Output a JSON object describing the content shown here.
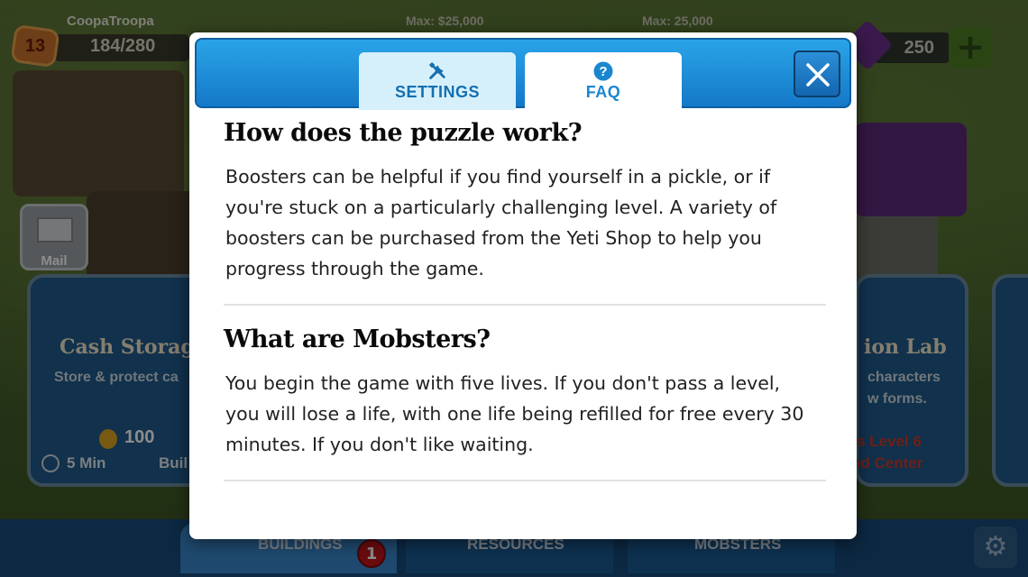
{
  "hud": {
    "player_name": "CoopaTroopa",
    "level": "13",
    "health": "184/280",
    "max_label_1": "Max: $25,000",
    "max_label_2": "Max: 25,000",
    "gems": "250",
    "plus": "+"
  },
  "background": {
    "mail_label": "Mail",
    "left_card_title": "Cash Storag",
    "left_card_sub": "Store & protect ca",
    "left_card_cost": "100",
    "left_card_time": "5 Min",
    "left_card_build": "Buil",
    "right_card_title": "ion Lab",
    "right_card_sub1": "characters",
    "right_card_sub2": "w forms.",
    "right_req_1": "s Level 6",
    "right_req_2": "nd Center",
    "bottom_tabs": [
      "BUILDINGS",
      "RESOURCES",
      "MOBSTERS"
    ],
    "buildings_badge": "1"
  },
  "modal": {
    "tabs": [
      {
        "label": "SETTINGS",
        "icon": "wrench-screwdriver-icon"
      },
      {
        "label": "FAQ",
        "icon": "question-mark-icon"
      }
    ],
    "active_tab": "FAQ",
    "faq": [
      {
        "question": "How does the puzzle work?",
        "answer": "Boosters can be helpful if you find yourself in a pickle, or if you're stuck on a particularly challenging level. A variety of boosters can be purchased from the Yeti Shop to help you progress through the game."
      },
      {
        "question": "What are Mobsters?",
        "answer": "You begin the game with five lives. If you don't pass a level, you will lose a life, with one life being refilled for free every 30 minutes. If you don't like waiting."
      }
    ]
  },
  "colors": {
    "header_blue": "#1b86d0",
    "tab_inactive": "#d6f0fb",
    "modal_bg": "#ffffff"
  }
}
